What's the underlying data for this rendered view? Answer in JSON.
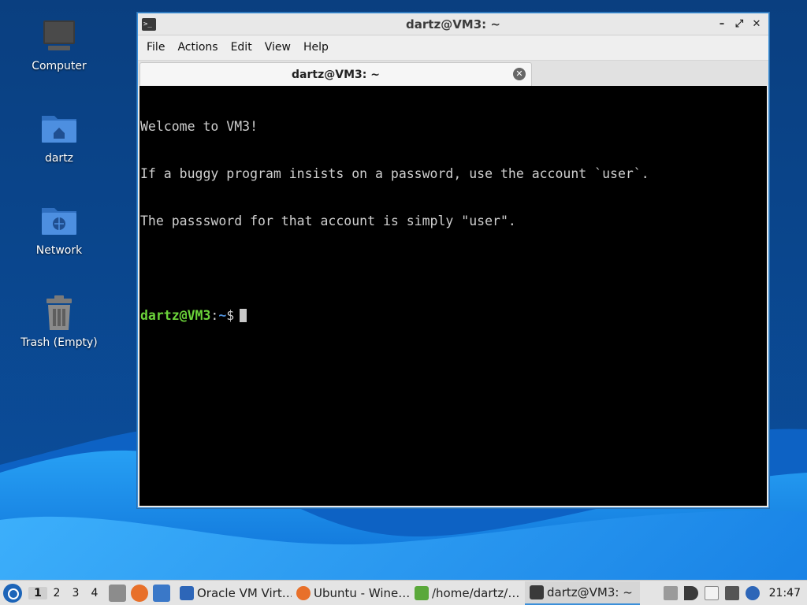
{
  "colors": {
    "wallpaper_dark": "#063a78",
    "wallpaper_wave": "#1e88e5",
    "terminal_bg": "#000000",
    "prompt_user": "#6bd33a",
    "prompt_path": "#4f8fd8",
    "window_border": "#3b8fd9"
  },
  "desktop": {
    "icons": [
      {
        "label": "Computer",
        "icon": "monitor-icon"
      },
      {
        "label": "dartz",
        "icon": "home-folder-icon"
      },
      {
        "label": "Network",
        "icon": "network-folder-icon"
      },
      {
        "label": "Trash (Empty)",
        "icon": "trash-icon"
      }
    ]
  },
  "window": {
    "title": "dartz@VM3: ~",
    "app_icon": "terminal-icon",
    "minimize": "–",
    "maximize": "⤢",
    "close": "✕",
    "menu": [
      "File",
      "Actions",
      "Edit",
      "View",
      "Help"
    ],
    "tab": {
      "label": "dartz@VM3: ~",
      "close": "✕"
    }
  },
  "terminal": {
    "lines": [
      "Welcome to VM3!",
      "If a buggy program insists on a password, use the account `user`.",
      "The passsword for that account is simply \"user\".",
      ""
    ],
    "prompt_user": "dartz@VM3",
    "prompt_sep": ":",
    "prompt_path": "~",
    "prompt_end": "$"
  },
  "taskbar": {
    "desktops": [
      "1",
      "2",
      "3",
      "4"
    ],
    "tasks": [
      {
        "label": "Oracle VM Virt…",
        "icon": "virtualbox-icon"
      },
      {
        "label": "Ubuntu - Wine…",
        "icon": "firefox-icon"
      },
      {
        "label": "/home/dartz/…",
        "icon": "archive-icon"
      },
      {
        "label": "dartz@VM3: ~",
        "icon": "terminal-icon"
      }
    ],
    "clock": "21:47"
  }
}
